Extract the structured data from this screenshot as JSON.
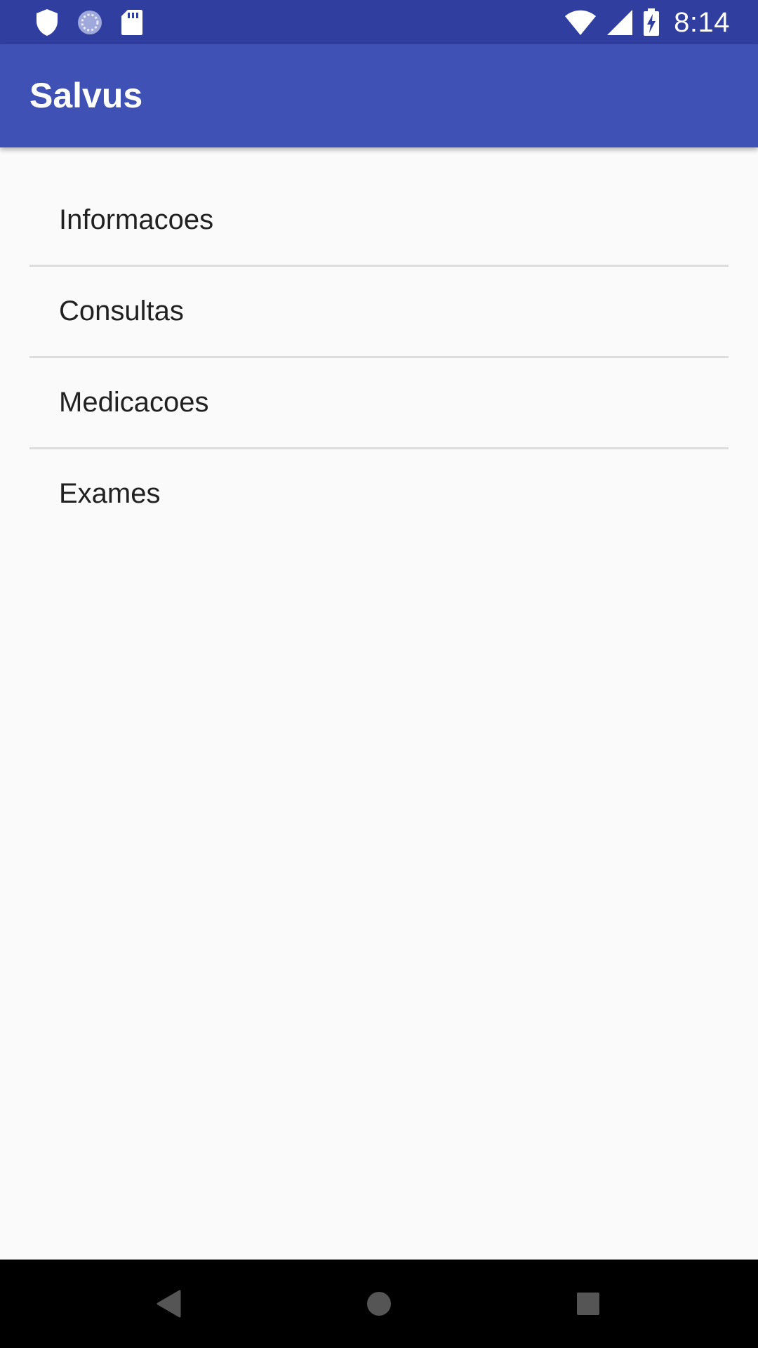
{
  "status_bar": {
    "time": "8:14",
    "left_icons": [
      "shield-icon",
      "sync-icon",
      "sd-card-icon"
    ],
    "right_icons": [
      "wifi-icon",
      "signal-icon",
      "battery-charging-icon"
    ],
    "background": "#303F9F"
  },
  "app_bar": {
    "title": "Salvus",
    "background": "#3F51B5"
  },
  "menu": {
    "items": [
      {
        "label": "Informacoes"
      },
      {
        "label": "Consultas"
      },
      {
        "label": "Medicacoes"
      },
      {
        "label": "Exames"
      }
    ]
  },
  "nav_bar": {
    "buttons": [
      "back-icon",
      "home-icon",
      "recents-icon"
    ]
  }
}
